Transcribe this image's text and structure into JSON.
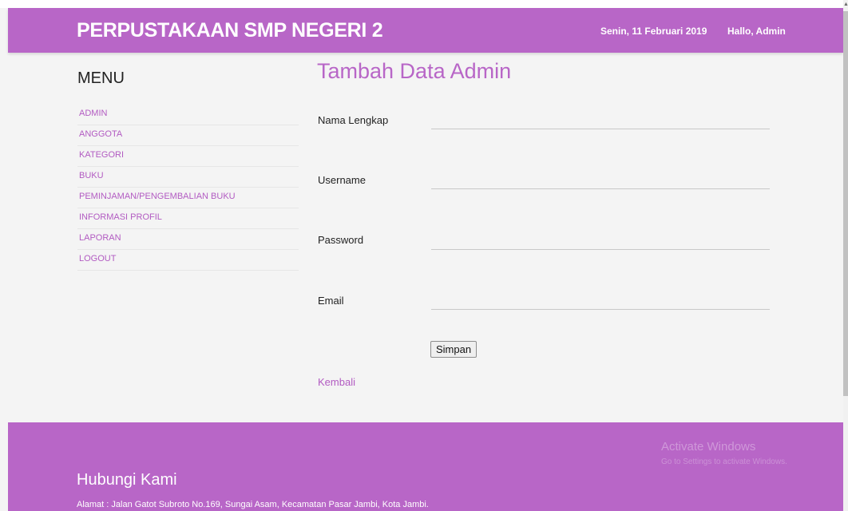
{
  "header": {
    "title": "PERPUSTAKAAN SMP NEGERI 2",
    "date": "Senin, 11 Februari 2019",
    "greeting": "Hallo, Admin"
  },
  "sidebar": {
    "title": "MENU",
    "items": [
      {
        "label": "ADMIN"
      },
      {
        "label": "ANGGOTA"
      },
      {
        "label": "KATEGORI"
      },
      {
        "label": "BUKU"
      },
      {
        "label": "PEMINJAMAN/PENGEMBALIAN BUKU"
      },
      {
        "label": "INFORMASI PROFIL"
      },
      {
        "label": "LAPORAN"
      },
      {
        "label": "LOGOUT"
      }
    ]
  },
  "form": {
    "title": "Tambah Data Admin",
    "fields": [
      {
        "label": "Nama Lengkap",
        "value": ""
      },
      {
        "label": "Username",
        "value": ""
      },
      {
        "label": "Password",
        "value": ""
      },
      {
        "label": "Email",
        "value": ""
      }
    ],
    "submit_label": "Simpan",
    "back_label": "Kembali"
  },
  "footer": {
    "title": "Hubungi Kami",
    "address": "Alamat : Jalan Gatot Subroto No.169, Sungai Asam, Kecamatan Pasar Jambi, Kota Jambi."
  },
  "watermark": {
    "title": "Activate Windows",
    "subtitle": "Go to Settings to activate Windows."
  },
  "colors": {
    "accent": "#b866c7",
    "link": "#b25bc2",
    "background": "#f4f4f4"
  }
}
